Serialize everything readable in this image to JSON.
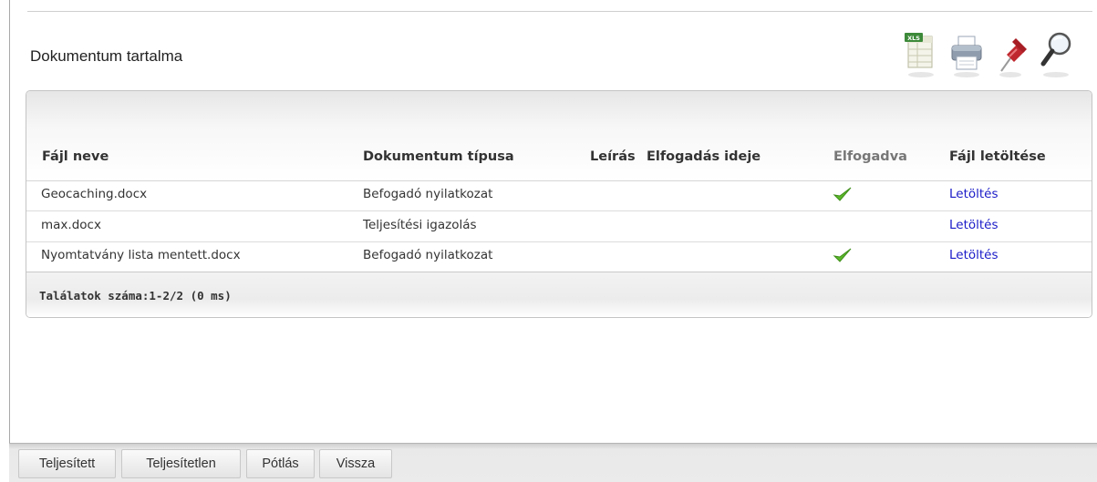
{
  "page": {
    "title": "Dokumentum tartalma"
  },
  "toolbar": [
    {
      "icon": "xls-export-icon",
      "label": "XLS"
    },
    {
      "icon": "printer-icon"
    },
    {
      "icon": "pin-icon"
    },
    {
      "icon": "magnifier-icon"
    }
  ],
  "table": {
    "columns": [
      "Fájl neve",
      "Dokumentum típusa",
      "Leírás",
      "Elfogadás ideje",
      "Elfogadva",
      "Fájl letöltése"
    ],
    "rows": [
      {
        "file_name": "Geocaching.docx",
        "doc_type": "Befogadó nyilatkozat",
        "description": "",
        "accepted_at": "",
        "accepted": true,
        "download": "Letöltés"
      },
      {
        "file_name": "max.docx",
        "doc_type": "Teljesítési igazolás",
        "description": "",
        "accepted_at": "",
        "accepted": false,
        "download": "Letöltés"
      },
      {
        "file_name": "Nyomtatvány lista mentett.docx",
        "doc_type": "Befogadó nyilatkozat",
        "description": "",
        "accepted_at": "",
        "accepted": true,
        "download": "Letöltés"
      }
    ],
    "footer": "Találatok száma:1-2/2 (0 ms)"
  },
  "buttons": [
    "Teljesített",
    "Teljesítetlen",
    "Pótlás",
    "Vissza"
  ],
  "colors": {
    "link": "#1a1ac8",
    "check": "#5cb82a",
    "xls_green": "#3d8a3a",
    "pin_red": "#c0282f"
  }
}
